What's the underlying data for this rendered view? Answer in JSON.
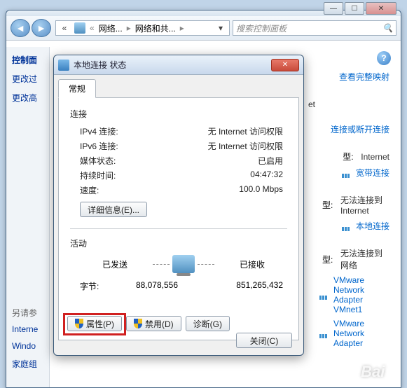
{
  "cp": {
    "breadcrumb": {
      "level1_short": "网络...",
      "level2_short": "网络和共..."
    },
    "search_placeholder": "搜索控制面板",
    "sidebar": {
      "header": "控制面",
      "items": [
        "更改过",
        "更改高"
      ],
      "related_header": "另请参",
      "related": [
        "Interne",
        "Windo",
        "家庭组"
      ]
    },
    "main": {
      "link_map": "查看完整映射",
      "net_suffix": "et",
      "link_conn": "连接或断开连接",
      "rows": [
        {
          "label": "型:",
          "value": "Internet",
          "conn": "宽带连接"
        },
        {
          "label": "型:",
          "value": "无法连接到 Internet",
          "conn": "本地连接"
        },
        {
          "label": "型:",
          "value": "无法连接到网络",
          "conn": "VMware Network Adapter VMnet1"
        }
      ],
      "extra_conn": "VMware Network Adapter"
    }
  },
  "dlg": {
    "title": "本地连接 状态",
    "tab": "常规",
    "conn_section": "连接",
    "conn": {
      "ipv4_k": "IPv4 连接:",
      "ipv4_v": "无 Internet 访问权限",
      "ipv6_k": "IPv6 连接:",
      "ipv6_v": "无 Internet 访问权限",
      "media_k": "媒体状态:",
      "media_v": "已启用",
      "duration_k": "持续时间:",
      "duration_v": "04:47:32",
      "speed_k": "速度:",
      "speed_v": "100.0 Mbps"
    },
    "details_btn": "详细信息(E)...",
    "activity_section": "活动",
    "sent_label": "已发送",
    "recv_label": "已接收",
    "bytes_label": "字节:",
    "bytes_sent": "88,078,556",
    "bytes_recv": "851,265,432",
    "btn_props": "属性(P)",
    "btn_disable": "禁用(D)",
    "btn_diag": "诊断(G)",
    "btn_close": "关闭(C)"
  }
}
